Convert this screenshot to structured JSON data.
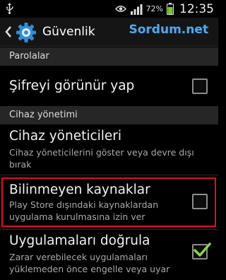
{
  "status_bar": {
    "icons": [
      "usb-icon",
      "eye-icon",
      "signal-icon",
      "battery-icon"
    ],
    "battery": "72%",
    "time": "12:35"
  },
  "action_bar": {
    "title": "Güvenlik",
    "watermark": "Sordum.net",
    "icons": [
      "back-icon",
      "settings-gear-icon"
    ]
  },
  "sections": [
    {
      "header": "Parolalar",
      "items": [
        {
          "title": "Şifreyi görünür yap",
          "checkbox": true,
          "checked": false
        }
      ]
    },
    {
      "header": "Cihaz yönetimi",
      "items": [
        {
          "title": "Cihaz yöneticileri",
          "summary": "Cihaz yöneticilerini göster veya devre dışı bırak",
          "checkbox": false
        },
        {
          "title": "Bilinmeyen kaynaklar",
          "summary": "Play Store dışındaki kaynaklardan uygulama kurulmasına izin ver",
          "checkbox": true,
          "checked": false,
          "highlighted": true
        },
        {
          "title": "Uygulamaları doğrula",
          "summary": "Zarar verebilecek uygulamaları yüklemeden önce engelle veya uyar",
          "checkbox": true,
          "checked": true
        }
      ]
    }
  ],
  "colors": {
    "accent": "#33b5e5",
    "highlight_border": "#e0101c",
    "check_mark": "#8bd44a",
    "watermark": "#58a6e8"
  }
}
